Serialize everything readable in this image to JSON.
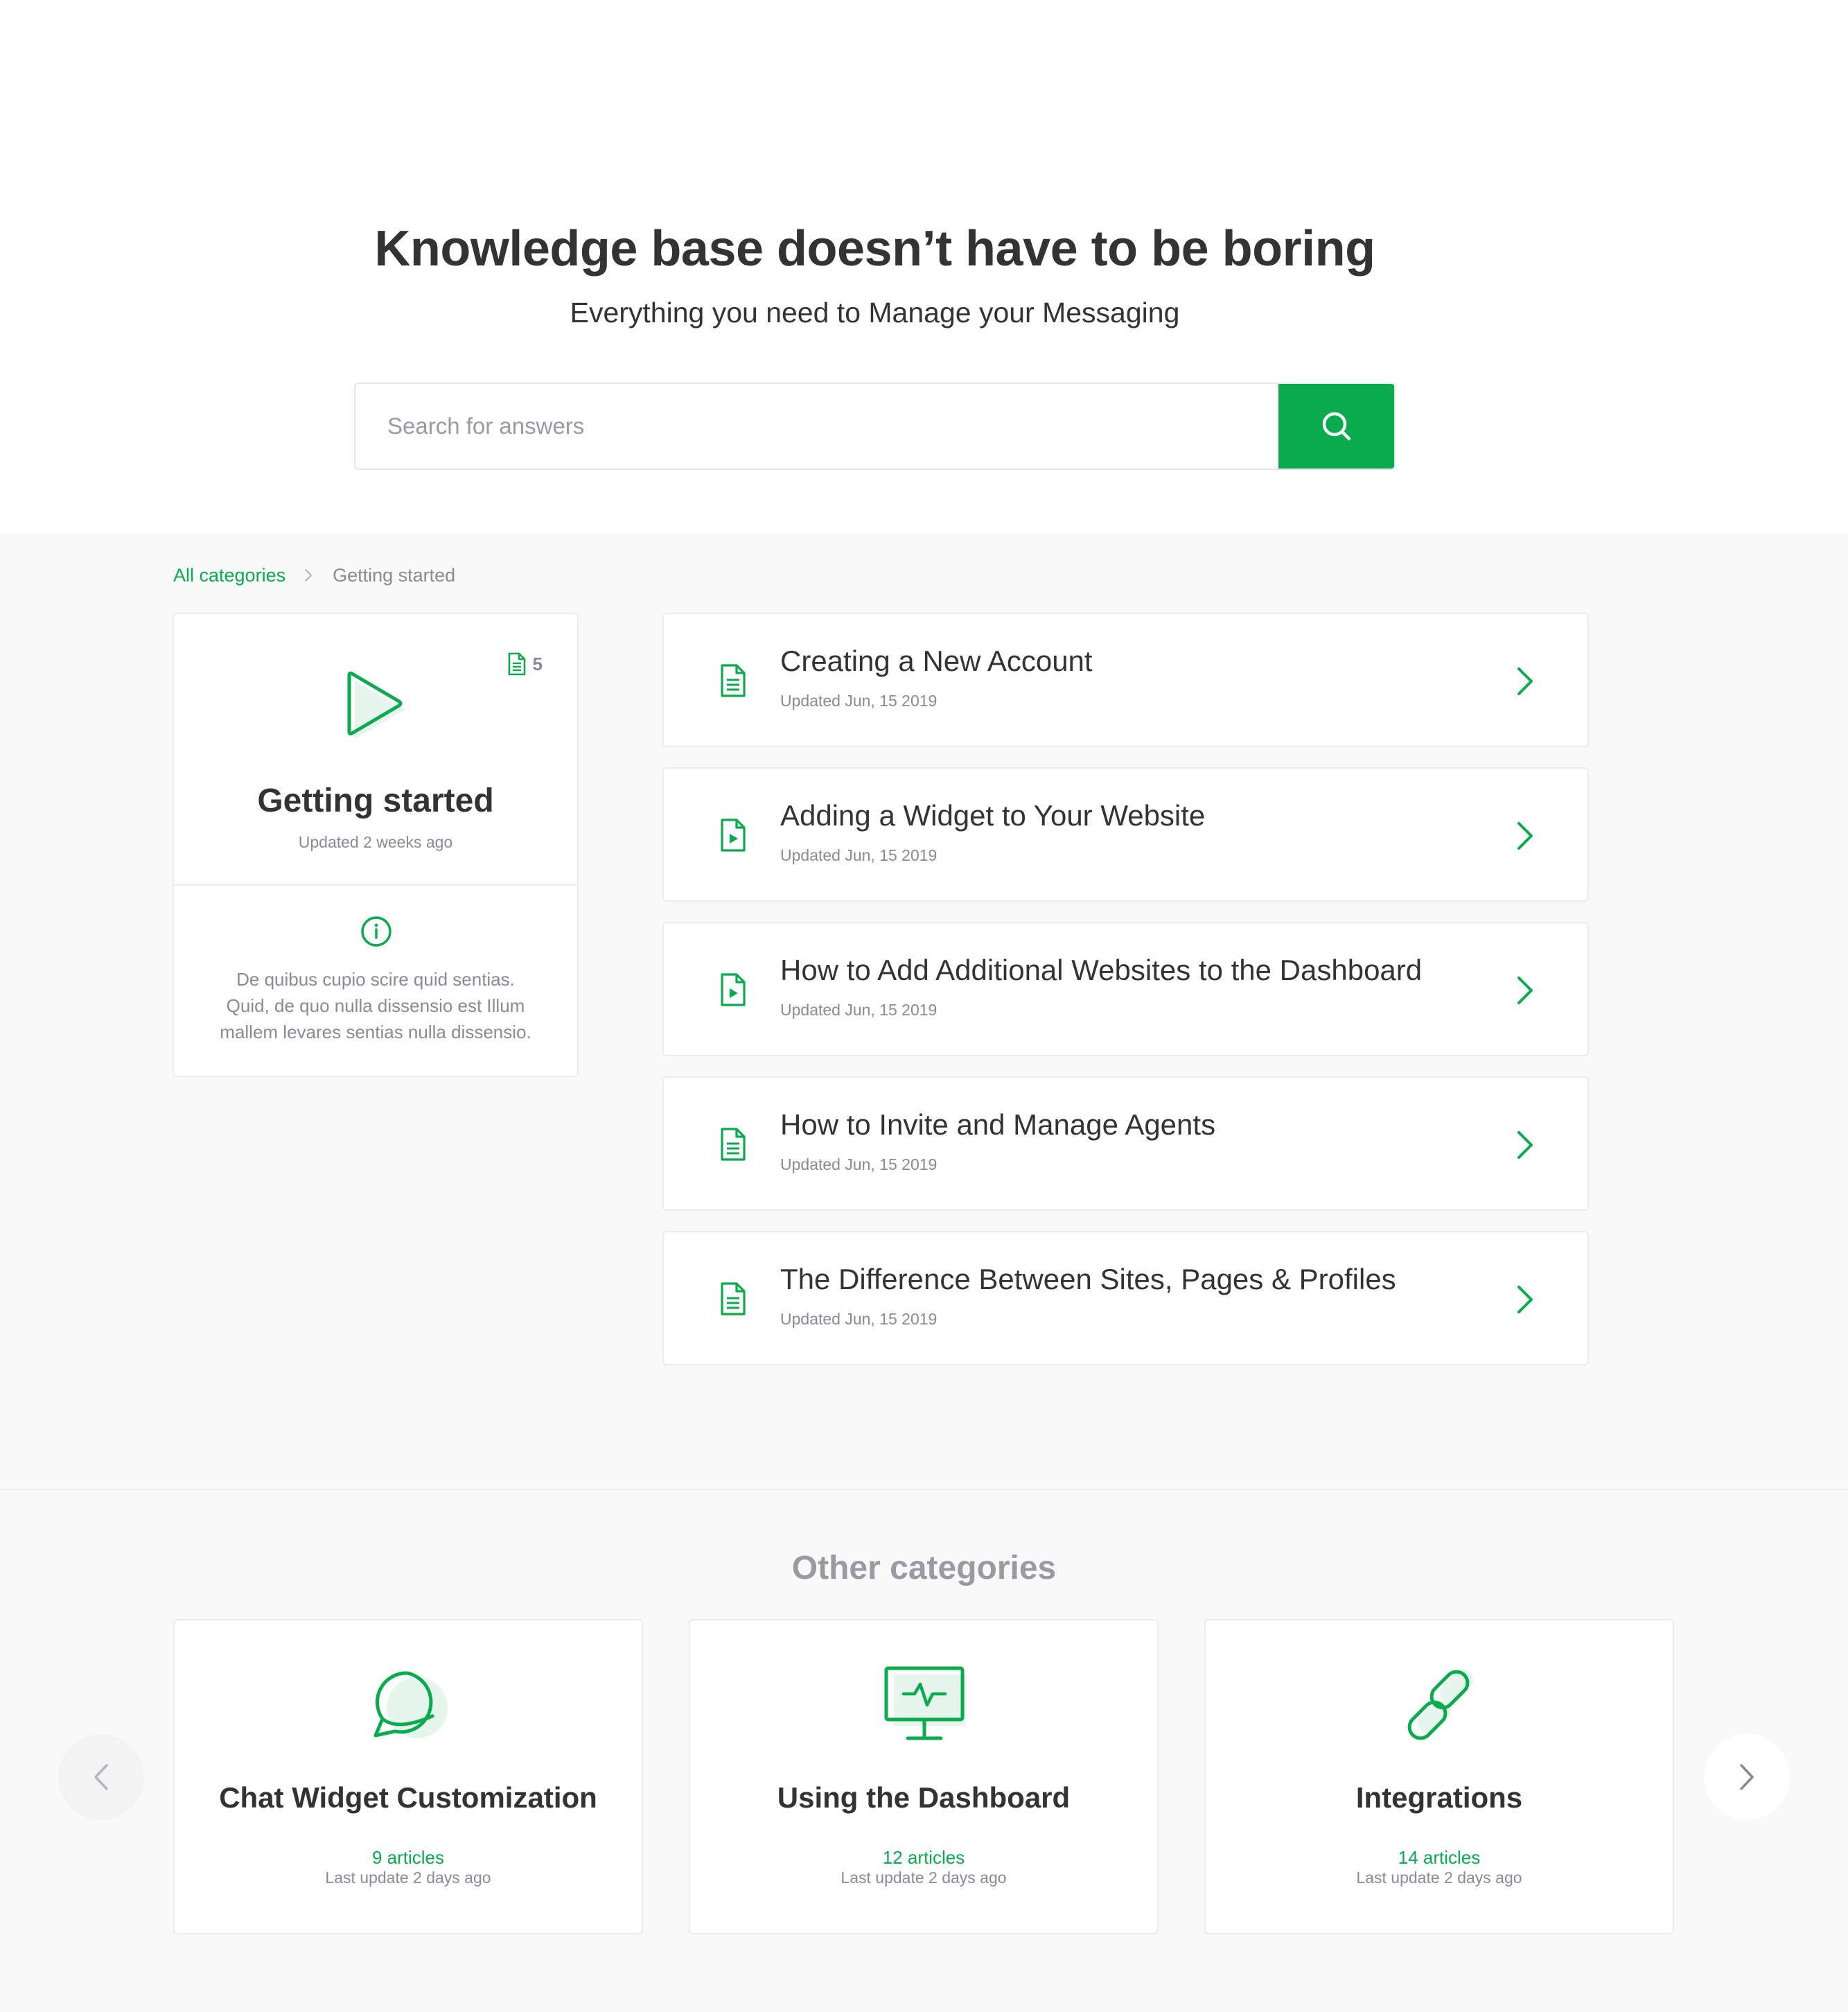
{
  "hero": {
    "title": "Knowledge base doesn’t have to be boring",
    "subtitle": "Everything you need to Manage your Messaging"
  },
  "search": {
    "placeholder": "Search for answers",
    "value": "",
    "button_icon": "search-icon"
  },
  "breadcrumb": {
    "root": "All categories",
    "separator_icon": "chevron-right-icon",
    "current": "Getting started"
  },
  "category": {
    "icon": "play-icon",
    "count_icon": "document-icon",
    "article_count": "5",
    "title": "Getting started",
    "updated": "Updated 2 weeks ago",
    "info_icon": "info-icon",
    "description": "De quibus cupio scire quid sentias. Quid, de quo nulla dissensio est Illum mallem levares sentias nulla dissensio."
  },
  "articles": [
    {
      "title": "Creating a New Account",
      "updated": "Updated Jun, 15 2019",
      "icon": "document-text-icon"
    },
    {
      "title": "Adding a Widget to Your Website",
      "updated": "Updated Jun, 15 2019",
      "icon": "document-video-icon"
    },
    {
      "title": "How to Add Additional Websites to the Dashboard",
      "updated": "Updated Jun, 15 2019",
      "icon": "document-video-icon"
    },
    {
      "title": "How to Invite and Manage Agents",
      "updated": "Updated Jun, 15 2019",
      "icon": "document-text-icon"
    },
    {
      "title": "The Difference Between Sites, Pages & Profiles",
      "updated": "Updated Jun, 15 2019",
      "icon": "document-text-icon"
    }
  ],
  "other_categories": {
    "title": "Other categories",
    "prev_icon": "chevron-left-icon",
    "next_icon": "chevron-right-icon",
    "items": [
      {
        "name": "Chat Widget Customization",
        "articles": "9 articles",
        "updated": "Last update 2 days ago",
        "icon": "chat-bubble-icon"
      },
      {
        "name": "Using the Dashboard",
        "articles": "12 articles",
        "updated": "Last update 2 days ago",
        "icon": "monitor-icon"
      },
      {
        "name": "Integrations",
        "articles": "14 articles",
        "updated": "Last update 2 days ago",
        "icon": "link-icon"
      }
    ]
  },
  "colors": {
    "accent": "#0aaa4e",
    "accent_light": "#e6f6ec",
    "text": "#333333",
    "muted": "#8a8a93",
    "background_gray": "#f9f9f9",
    "border": "#ececec"
  }
}
